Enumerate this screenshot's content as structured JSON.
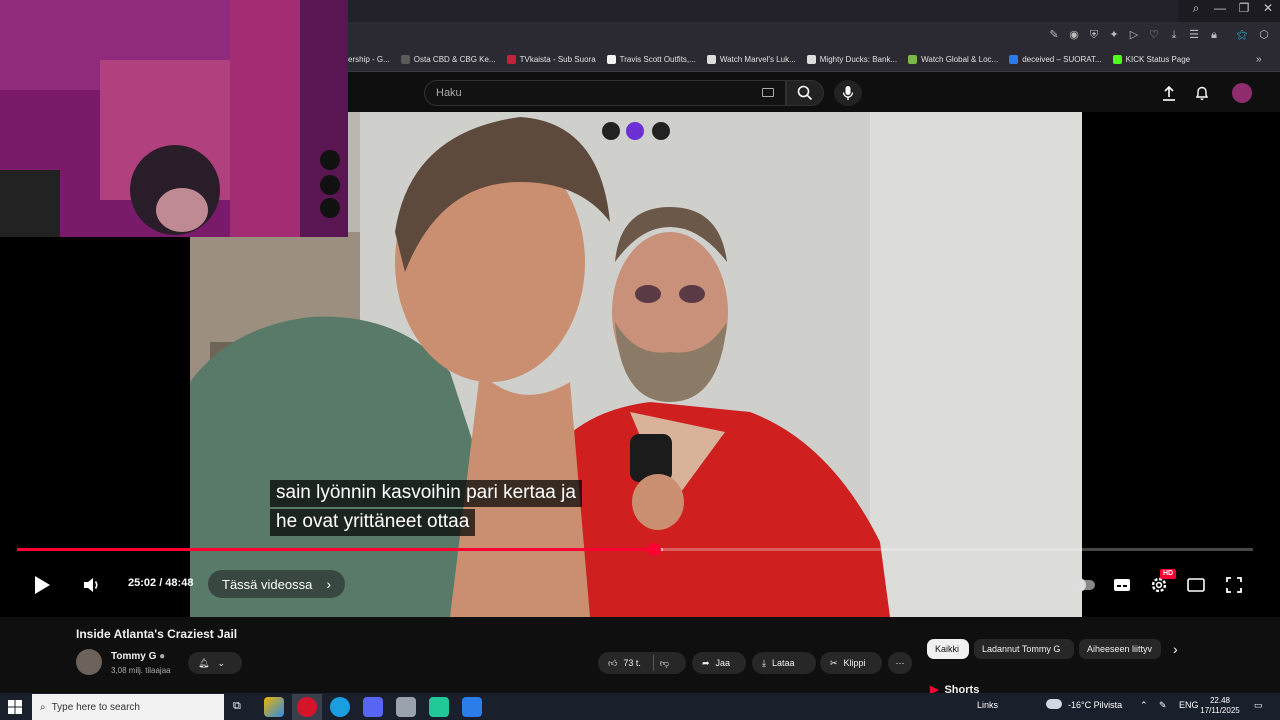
{
  "bookmarks": [
    {
      "label": "ership - G...",
      "color": "#2c2c2c"
    },
    {
      "label": "Osta CBD & CBG Ke...",
      "color": "#5a5a5a"
    },
    {
      "label": "TVkaista - Sub Suora",
      "color": "#c0243c"
    },
    {
      "label": "Travis Scott Outfits,...",
      "color": "#f2f2f2"
    },
    {
      "label": "Watch Marvel's Luk...",
      "color": "#dddddd"
    },
    {
      "label": "Mighty Ducks: Bank...",
      "color": "#dddddd"
    },
    {
      "label": "Watch Global & Loc...",
      "color": "#7ab648"
    },
    {
      "label": "deceived – SUORAT...",
      "color": "#2d7be6"
    },
    {
      "label": "KICK Status Page",
      "color": "#53fc18"
    }
  ],
  "search": {
    "placeholder": "Haku"
  },
  "video": {
    "caption_line1": "sain lyönnin kasvoihin pari kertaa ja",
    "caption_line2": "he ovat yrittäneet ottaa",
    "time": "25:02 / 48:48",
    "chapter": "Tässä videossa",
    "progress_fraction": 0.515,
    "buffer_fraction": 0.523,
    "quality_badge": "HD"
  },
  "details": {
    "title": "Inside Atlanta's Craziest Jail",
    "channel": "Tommy G",
    "subscribers": "3,08 milj. tilaajaa",
    "likes": "73 t.",
    "share": "Jaa",
    "download": "Lataa",
    "clip": "Klippi"
  },
  "chips": [
    "Kaikki",
    "Ladannut Tommy G",
    "Aiheeseen liittyv"
  ],
  "shorts_label": "Shorts",
  "taskbar": {
    "search_placeholder": "Type here to search",
    "links": "Links",
    "weather": "-16°C  Pilvista",
    "lang": "ENG",
    "time": "22.48",
    "date": "17/11/2025"
  },
  "colors": {
    "accent": "#ff0033",
    "background": "#0f0f0f"
  }
}
